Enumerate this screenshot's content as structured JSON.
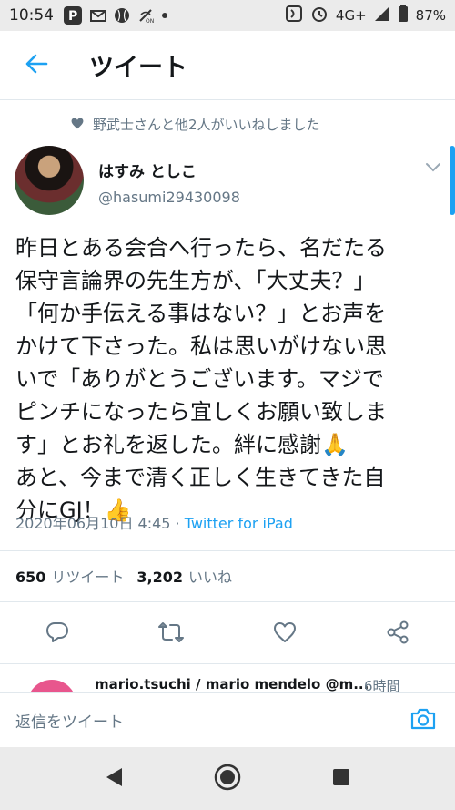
{
  "status_bar": {
    "time": "10:54",
    "network": "4G+",
    "battery": "87%"
  },
  "app_bar": {
    "title": "ツイート"
  },
  "liked_by": "野武士さんと他2人がいいねしました",
  "author": {
    "display_name": "はすみ としこ",
    "handle": "@hasumi29430098"
  },
  "tweet": {
    "text": "昨日とある会合へ行ったら、名だたる\n保守言論界の先生方が、「大丈夫？」\n「何か手伝える事はない？」とお声を\nかけて下さった。私は思いがけない思\nいで「ありがとうございます。マジで\nピンチになったら宜しくお願い致しま\nす」とお礼を返した。絆に感謝🙏\nあと、今まで清く正しく生きてきた自\n分にGJ！👍",
    "timestamp": "2020年06月10日 4:45 · ",
    "via": "Twitter for iPad"
  },
  "stats": {
    "retweets_count": "650",
    "retweets_label": "リツイート",
    "likes_count": "3,202",
    "likes_label": "いいね"
  },
  "next_reply": {
    "name": "mario.tsuchi / mario mendelo @m...",
    "time": "6時間"
  },
  "reply_bar": {
    "placeholder": "返信をツイート"
  },
  "colors": {
    "accent": "#1da1f2",
    "muted": "#657786",
    "text": "#14171a"
  }
}
